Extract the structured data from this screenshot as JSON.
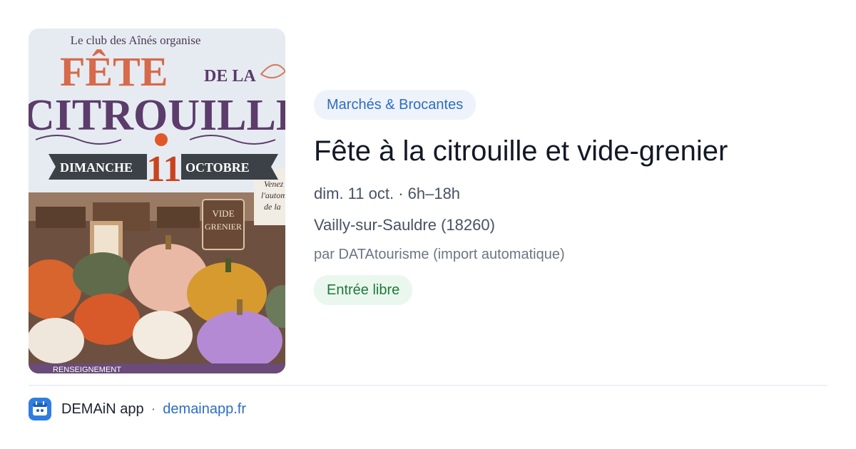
{
  "poster": {
    "top_text": "Le club des Aînés organise",
    "line_fete": "FÊTE",
    "line_dela": "DE LA",
    "line_citrouille": "CITROUILLE",
    "day_left": "DIMANCHE",
    "day_number": "11",
    "day_right": "OCTOBRE",
    "side_note_1": "Venez",
    "side_note_2": "l'autom",
    "side_note_3": "de la",
    "sign_line_1": "VIDE",
    "sign_line_2": "GRENIER",
    "bottom_text": "RENSEIGNEMENT"
  },
  "event": {
    "category": "Marchés & Brocantes",
    "title": "Fête à la citrouille et vide-grenier",
    "datetime": "dim. 11 oct. · 6h–18h",
    "location": "Vailly-sur-Sauldre (18260)",
    "organizer": "par DATAtourisme (import automatique)",
    "price_badge": "Entrée libre"
  },
  "footer": {
    "app_name": "DEMAiN app",
    "separator": "·",
    "site": "demainapp.fr"
  },
  "colors": {
    "category_bg": "#eef3fb",
    "category_text": "#2e6cc4",
    "free_bg": "#eaf7ee",
    "free_text": "#1f7a3a",
    "app_icon": "#2f7de1"
  }
}
